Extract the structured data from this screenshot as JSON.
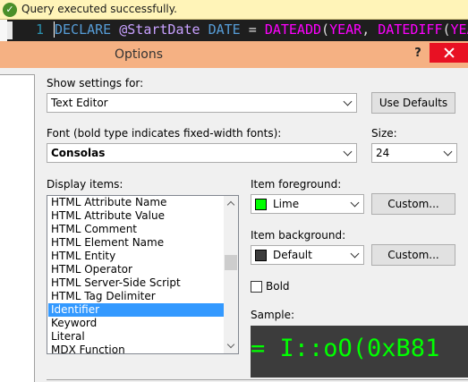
{
  "status_bar": {
    "message": "Query executed successfully.",
    "icon": "check-icon"
  },
  "editor": {
    "line_number": "1",
    "code": {
      "kw1": "DECLARE",
      "var": "@StartDate",
      "kw2": "DATE",
      "op": "=",
      "fn1": "DATEADD",
      "p1": "(",
      "kw3": "YEAR",
      "comma": ",",
      "fn2": "DATEDIFF",
      "p2": "(",
      "kw4": "YEAR"
    }
  },
  "dialog": {
    "title": "Options",
    "help_label": "?",
    "show_settings_for": {
      "label": "Show settings for:",
      "value": "Text Editor"
    },
    "use_defaults_label": "Use Defaults",
    "font": {
      "label": "Font (bold type indicates fixed-width fonts):",
      "value": "Consolas"
    },
    "size": {
      "label": "Size:",
      "value": "24"
    },
    "display_items": {
      "label": "Display items:",
      "items": [
        "HTML Attribute Name",
        "HTML Attribute Value",
        "HTML Comment",
        "HTML Element Name",
        "HTML Entity",
        "HTML Operator",
        "HTML Server-Side Script",
        "HTML Tag Delimiter",
        "Identifier",
        "Keyword",
        "Literal",
        "MDX Function"
      ],
      "selected": "Identifier"
    },
    "item_foreground": {
      "label": "Item foreground:",
      "value": "Lime",
      "swatch_color": "#00ff00",
      "custom_label": "Custom..."
    },
    "item_background": {
      "label": "Item background:",
      "value": "Default",
      "swatch_color": "#3c3c3c",
      "custom_label": "Custom..."
    },
    "bold": {
      "label": "Bold",
      "checked": false
    },
    "sample": {
      "label": "Sample:",
      "text": "= I::oO(0xB81",
      "text_color": "#00ff00",
      "background": "#3c3c3c"
    }
  },
  "colors": {
    "titlebar": "#f5b183",
    "close_button": "#e81123",
    "selection": "#3399ff",
    "status_bar": "#fff4b8"
  }
}
